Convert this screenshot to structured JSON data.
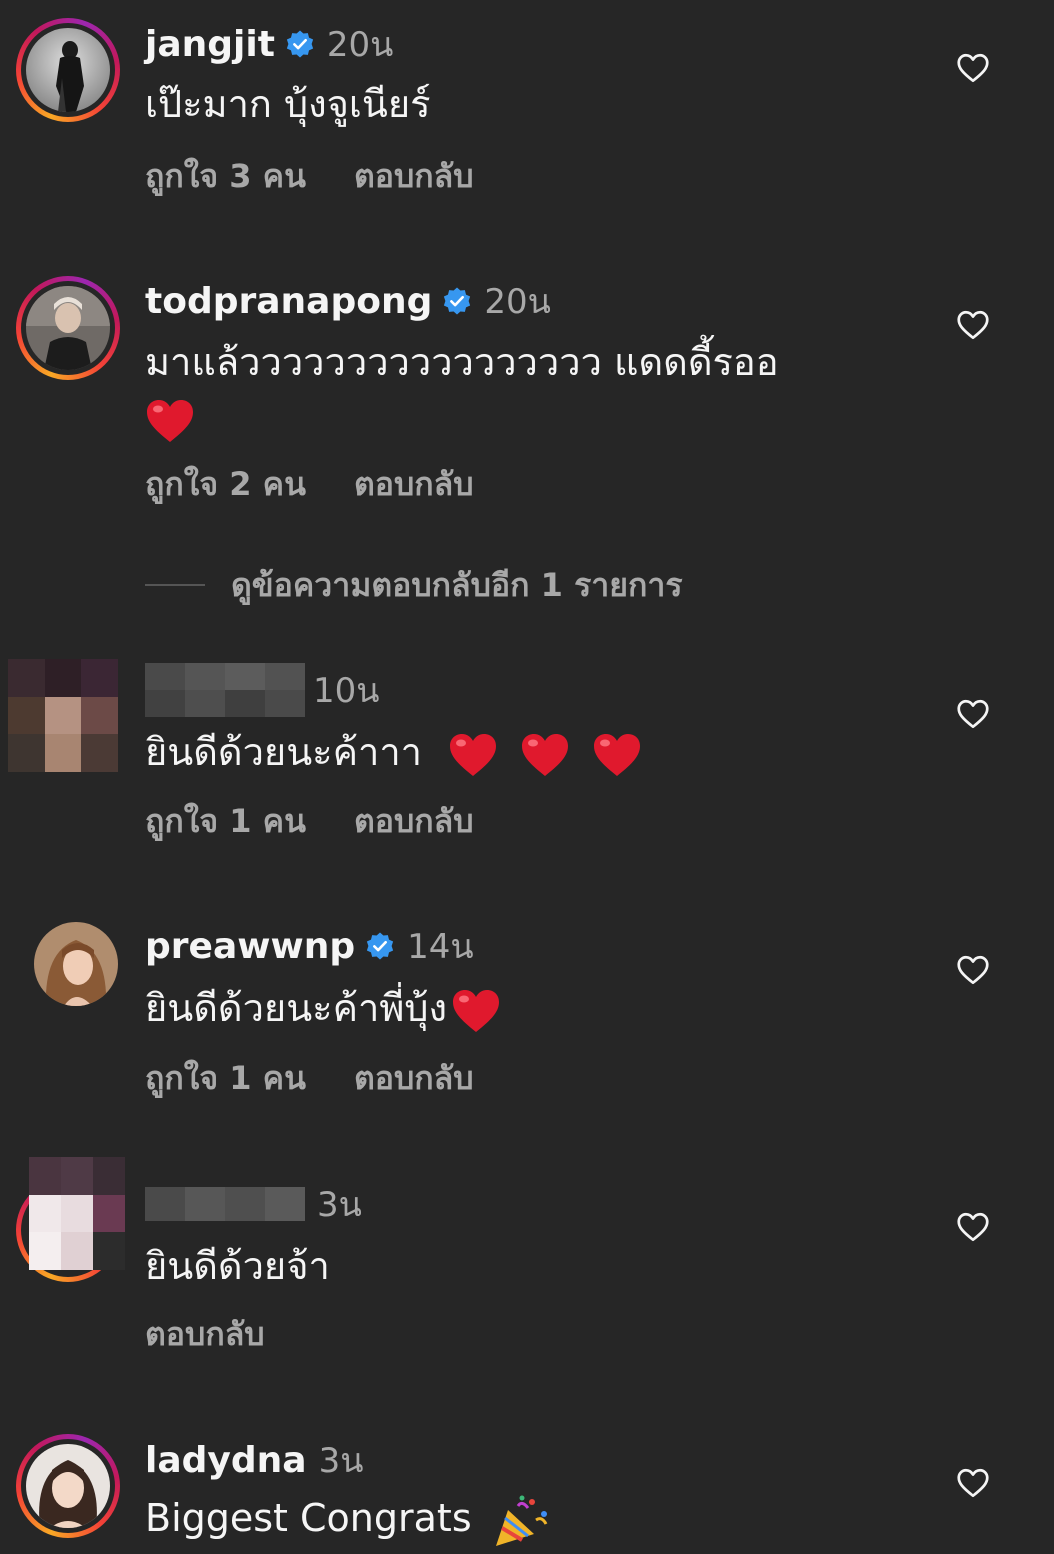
{
  "comments": [
    {
      "username": "jangjit",
      "verified": true,
      "time": "20น",
      "text": "เป๊ะมาก บุ้งจูเนียร์",
      "likes": "ถูกใจ 3 คน",
      "reply": "ตอบกลับ"
    },
    {
      "username": "todpranapong",
      "verified": true,
      "time": "20น",
      "text": "มาแล้ววววววววววววววววว แดดดี้รออ",
      "likes": "ถูกใจ 2 คน",
      "reply": "ตอบกลับ",
      "view_replies": "ดูข้อความตอบกลับอีก 1 รายการ"
    },
    {
      "username": "",
      "time": "10น",
      "text": "ยินดีด้วยนะค้าาา",
      "likes": "ถูกใจ 1 คน",
      "reply": "ตอบกลับ"
    },
    {
      "username": "preawwnp",
      "verified": true,
      "time": "14น",
      "text": "ยินดีด้วยนะค้าพี่บุ้ง",
      "likes": "ถูกใจ 1 คน",
      "reply": "ตอบกลับ"
    },
    {
      "username": "",
      "time": "3น",
      "text": "ยินดีด้วยจ้า",
      "reply": "ตอบกลับ"
    },
    {
      "username": "ladydna",
      "verified": false,
      "time": "3น",
      "text": "Biggest Congrats"
    }
  ],
  "colors": {
    "background": "#262626",
    "primary_text": "#f5f5f5",
    "secondary_text": "#a8a8a8",
    "verified_badge": "#3797f0",
    "heart_emoji": "#e0192d"
  },
  "icons": [
    "heart-outline-icon",
    "verified-badge-icon",
    "red-heart-emoji",
    "party-popper-emoji"
  ]
}
